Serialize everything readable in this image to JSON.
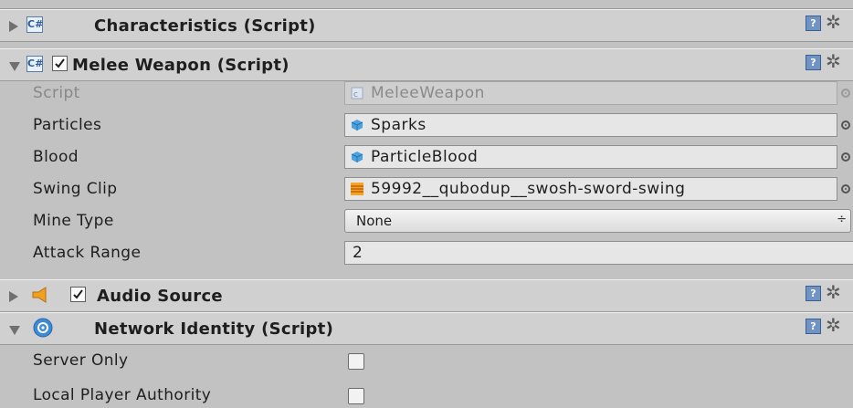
{
  "components": {
    "characteristics": {
      "title": "Characteristics (Script)"
    },
    "melee_weapon": {
      "title": "Melee Weapon (Script)",
      "fields": {
        "script": {
          "label": "Script",
          "value": "MeleeWeapon"
        },
        "particles": {
          "label": "Particles",
          "value": "Sparks"
        },
        "blood": {
          "label": "Blood",
          "value": "ParticleBlood"
        },
        "swing_clip": {
          "label": "Swing Clip",
          "value": "59992__qubodup__swosh-sword-swing"
        },
        "mine_type": {
          "label": "Mine Type",
          "value": "None"
        },
        "attack_range": {
          "label": "Attack Range",
          "value": "2"
        }
      }
    },
    "audio_source": {
      "title": "Audio Source"
    },
    "network_identity": {
      "title": "Network Identity (Script)",
      "fields": {
        "server_only": {
          "label": "Server Only",
          "checked": false
        },
        "local_player_authority": {
          "label": "Local Player Authority",
          "checked": false
        }
      }
    }
  },
  "icons": {
    "help": "?",
    "gear": "✲",
    "script": "C#",
    "select_arrows": "÷"
  },
  "colors": {
    "panel_bg": "#c2c2c2",
    "header_bg": "#d0d0d0",
    "prefab_blue": "#4aa3e0",
    "audio_orange": "#f0a020"
  }
}
